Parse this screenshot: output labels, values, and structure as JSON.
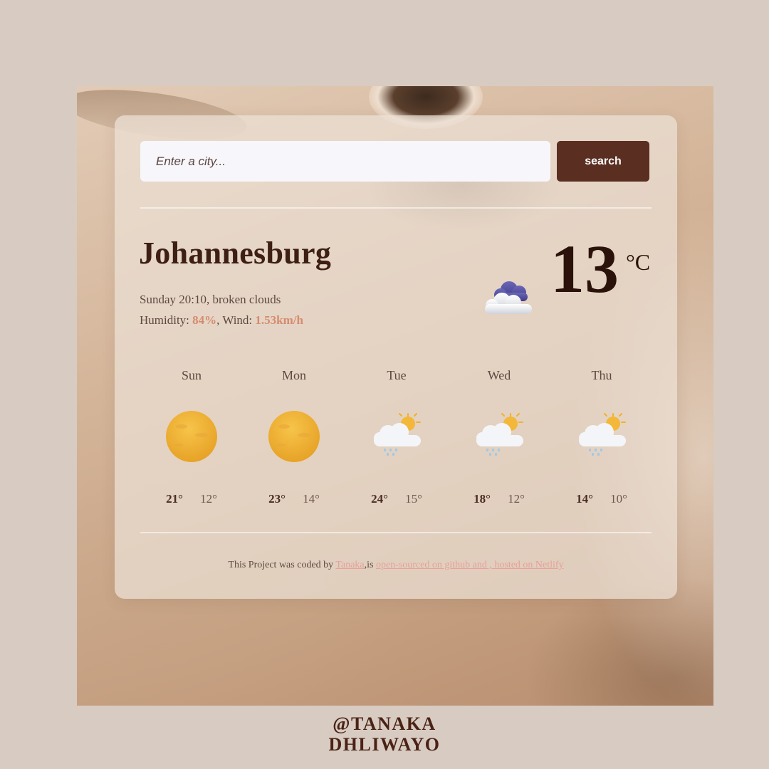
{
  "search": {
    "placeholder": "Enter a city...",
    "button_label": "search"
  },
  "current": {
    "city": "Johannesburg",
    "datetime_desc": "Sunday 20:10, broken clouds",
    "humidity_label": "Humidity:",
    "humidity_value": "84%",
    "wind_label": ", Wind:",
    "wind_value": "1.53km/h",
    "temperature": "13",
    "unit": "°C",
    "icon": "broken-clouds-icon"
  },
  "forecast": [
    {
      "day": "Sun",
      "max": "21°",
      "min": "12°",
      "icon": "sun-icon"
    },
    {
      "day": "Mon",
      "max": "23°",
      "min": "14°",
      "icon": "sun-icon"
    },
    {
      "day": "Tue",
      "max": "24°",
      "min": "15°",
      "icon": "sun-rain-cloud-icon"
    },
    {
      "day": "Wed",
      "max": "18°",
      "min": "12°",
      "icon": "sun-rain-cloud-icon"
    },
    {
      "day": "Thu",
      "max": "14°",
      "min": "10°",
      "icon": "sun-rain-cloud-icon"
    }
  ],
  "footer": {
    "prefix": "This Project was coded by ",
    "author_link": "Tanaka",
    "middle": ",is ",
    "source_link": "open-sourced on github and , hosted on Netlify"
  },
  "credit": {
    "line1": "@TANAKA",
    "line2": "DHLIWAYO"
  },
  "colors": {
    "background": "#d8cbc1",
    "button": "#5a2f22",
    "accent": "#d48c6f",
    "heading": "#3e1f14"
  }
}
